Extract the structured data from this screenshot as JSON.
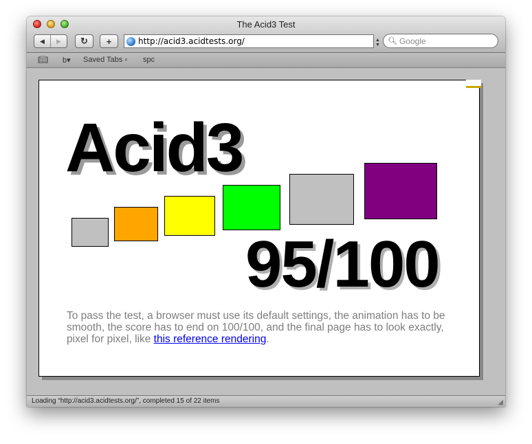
{
  "window": {
    "title": "The Acid3 Test"
  },
  "toolbar": {
    "back_glyph": "◀",
    "forward_glyph": "▶",
    "reload_glyph": "↻",
    "add_glyph": "+",
    "url": "http://acid3.acidtests.org/",
    "search_placeholder": "Google",
    "search_glyph": "🔍︎"
  },
  "bookmarks": {
    "book_glyph": "📖︎",
    "items": [
      {
        "label": "b▾"
      },
      {
        "label": "Saved Tabs ▫"
      },
      {
        "label": "spc"
      }
    ]
  },
  "page": {
    "title": "Acid3",
    "score": "95/100",
    "boxes": [
      {
        "color": "#c0c0c0"
      },
      {
        "color": "#ffa500"
      },
      {
        "color": "#ffff00"
      },
      {
        "color": "#00ff00"
      },
      {
        "color": "#c0c0c0"
      },
      {
        "color": "#800080"
      }
    ],
    "description_before": "To pass the test, a browser must use its default settings, the animation has to be smooth, the score has to end on 100/100, and the final page has to look exactly, pixel for pixel, like ",
    "link_text": "this reference rendering",
    "description_after": "."
  },
  "status": {
    "text": "Loading “http://acid3.acidtests.org/”, completed 15 of 22 items"
  },
  "colors": {
    "link": "#0000ee",
    "description": "#7d7d7d",
    "content_background": "#c0c0c0"
  }
}
